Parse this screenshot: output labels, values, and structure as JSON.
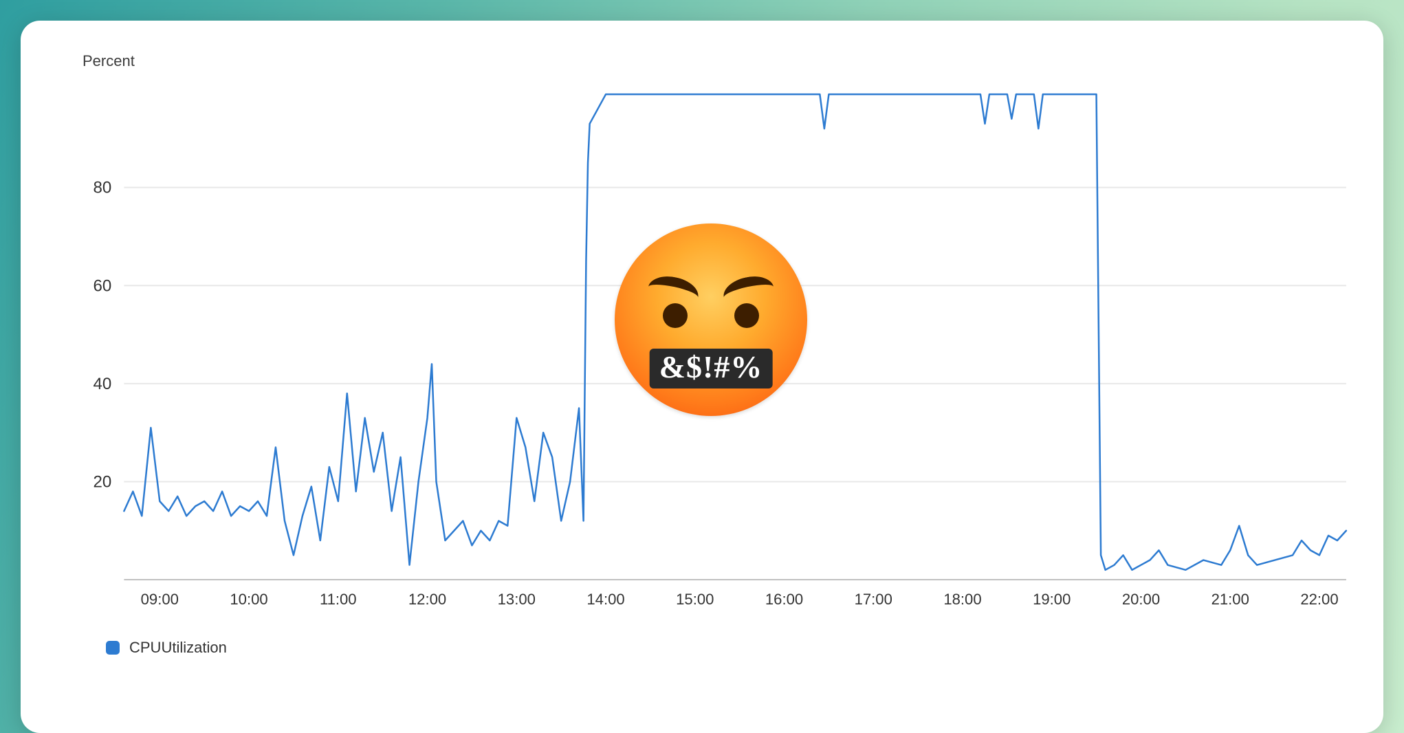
{
  "ylabel": "Percent",
  "legend": {
    "series_name": "CPUUtilization"
  },
  "emoji": {
    "mouth_text": "&$!#%"
  },
  "colors": {
    "series": "#2d7bd1"
  },
  "chart_data": {
    "type": "line",
    "title": "",
    "xlabel": "",
    "ylabel": "Percent",
    "ylim": [
      0,
      100
    ],
    "x_ticks": [
      "09:00",
      "10:00",
      "11:00",
      "12:00",
      "13:00",
      "14:00",
      "15:00",
      "16:00",
      "17:00",
      "18:00",
      "19:00",
      "20:00",
      "21:00",
      "22:00"
    ],
    "y_ticks": [
      20,
      40,
      60,
      80
    ],
    "series": [
      {
        "name": "CPUUtilization",
        "x": [
          8.6,
          8.7,
          8.8,
          8.9,
          9.0,
          9.1,
          9.2,
          9.3,
          9.4,
          9.5,
          9.6,
          9.7,
          9.8,
          9.9,
          10.0,
          10.1,
          10.2,
          10.3,
          10.4,
          10.5,
          10.6,
          10.7,
          10.8,
          10.9,
          11.0,
          11.1,
          11.2,
          11.3,
          11.4,
          11.5,
          11.6,
          11.7,
          11.8,
          11.9,
          12.0,
          12.05,
          12.1,
          12.2,
          12.3,
          12.4,
          12.5,
          12.6,
          12.7,
          12.8,
          12.9,
          13.0,
          13.1,
          13.2,
          13.3,
          13.4,
          13.5,
          13.6,
          13.7,
          13.75,
          13.78,
          13.8,
          13.82,
          14.0,
          14.5,
          15.0,
          15.5,
          16.0,
          16.4,
          16.45,
          16.5,
          17.0,
          17.5,
          18.0,
          18.2,
          18.25,
          18.3,
          18.5,
          18.55,
          18.6,
          18.8,
          18.85,
          18.9,
          19.0,
          19.2,
          19.4,
          19.5,
          19.55,
          19.6,
          19.7,
          19.8,
          19.9,
          20.0,
          20.1,
          20.2,
          20.3,
          20.5,
          20.7,
          20.9,
          21.0,
          21.1,
          21.2,
          21.3,
          21.5,
          21.7,
          21.8,
          21.9,
          22.0,
          22.1,
          22.2,
          22.3
        ],
        "y": [
          14,
          18,
          13,
          31,
          16,
          14,
          17,
          13,
          15,
          16,
          14,
          18,
          13,
          15,
          14,
          16,
          13,
          27,
          12,
          5,
          13,
          19,
          8,
          23,
          16,
          38,
          18,
          33,
          22,
          30,
          14,
          25,
          3,
          20,
          33,
          44,
          20,
          8,
          10,
          12,
          7,
          10,
          8,
          12,
          11,
          33,
          27,
          16,
          30,
          25,
          12,
          20,
          35,
          12,
          65,
          85,
          93,
          99,
          99,
          99,
          99,
          99,
          99,
          92,
          99,
          99,
          99,
          99,
          99,
          93,
          99,
          99,
          94,
          99,
          99,
          92,
          99,
          99,
          99,
          99,
          99,
          5,
          2,
          3,
          5,
          2,
          3,
          4,
          6,
          3,
          2,
          4,
          3,
          6,
          11,
          5,
          3,
          4,
          5,
          8,
          6,
          5,
          9,
          8,
          10
        ]
      }
    ]
  }
}
